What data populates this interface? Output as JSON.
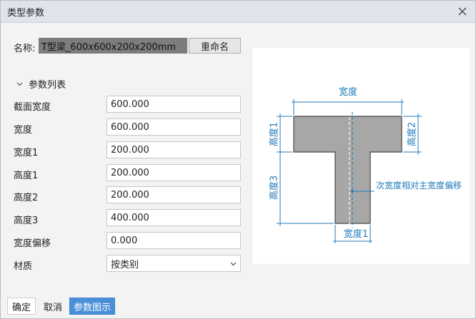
{
  "window": {
    "title": "类型参数"
  },
  "name_row": {
    "label": "名称:",
    "value": "T型梁_600x600x200x200mm",
    "rename_label": "重命名"
  },
  "section": {
    "label": "参数列表"
  },
  "params": [
    {
      "label": "截面宽度",
      "value": "600.000"
    },
    {
      "label": "宽度",
      "value": "600.000"
    },
    {
      "label": "宽度1",
      "value": "200.000"
    },
    {
      "label": "高度1",
      "value": "200.000"
    },
    {
      "label": "高度2",
      "value": "200.000"
    },
    {
      "label": "高度3",
      "value": "400.000"
    },
    {
      "label": "宽度偏移",
      "value": "0.000"
    }
  ],
  "material": {
    "label": "材质",
    "value": "按类别"
  },
  "diagram": {
    "width_label": "宽度",
    "h1_label": "高度1",
    "h2_label": "高度2",
    "h3_label": "高度3",
    "w1_label": "宽度1",
    "offset_label": "次宽度相对主宽度偏移"
  },
  "buttons": {
    "ok": "确定",
    "cancel": "取消",
    "params_diagram": "参数图示"
  },
  "colors": {
    "dimension": "#1f7ab8",
    "shape_fill": "#a7a7a7",
    "primary": "#4a90d9"
  },
  "icons": {
    "close": "close-icon",
    "collapse": "chevron-down-icon",
    "dropdown": "chevron-down-icon"
  }
}
